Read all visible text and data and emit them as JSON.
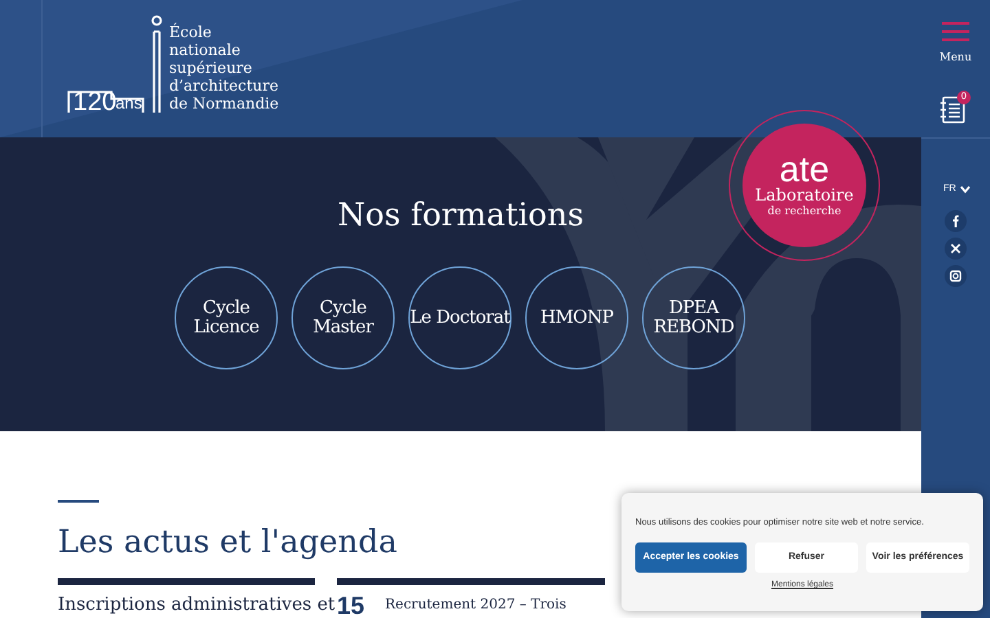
{
  "header": {
    "logo": {
      "years": "120",
      "years_unit": "ans",
      "name_lines": [
        "École",
        "nationale",
        "supérieure",
        "d’architecture",
        "de Normandie"
      ]
    },
    "menu": {
      "label": "Menu"
    },
    "selection": {
      "count": "0"
    }
  },
  "sidebar": {
    "language": "FR",
    "social": [
      {
        "kind": "facebook"
      },
      {
        "kind": "x"
      },
      {
        "kind": "instagram"
      }
    ]
  },
  "hero": {
    "title": "Nos formations",
    "formations": [
      {
        "lines": [
          "Cycle",
          "Licence"
        ]
      },
      {
        "lines": [
          "Cycle",
          "Master"
        ]
      },
      {
        "lines": [
          "Le Doctorat"
        ]
      },
      {
        "lines": [
          "HMONP"
        ]
      },
      {
        "lines": [
          "DPEA",
          "REBOND"
        ]
      }
    ]
  },
  "lab_badge": {
    "acronym": "ate",
    "title": "Laboratoire",
    "subtitle": "de recherche"
  },
  "news": {
    "title": "Les actus et l'agenda",
    "items": [
      {
        "kind": "news",
        "title": "Inscriptions administratives et"
      },
      {
        "kind": "event",
        "day": "15",
        "title": "Recrutement 2027 – Trois"
      }
    ]
  },
  "cookie_banner": {
    "text": "Nous utilisons des cookies pour optimiser notre site web et notre service.",
    "buttons": [
      {
        "label": "Accepter les cookies",
        "primary": true
      },
      {
        "label": "Refuser",
        "primary": false
      },
      {
        "label": "Voir les préférences",
        "primary": false
      }
    ],
    "link": "Mentions légales"
  }
}
